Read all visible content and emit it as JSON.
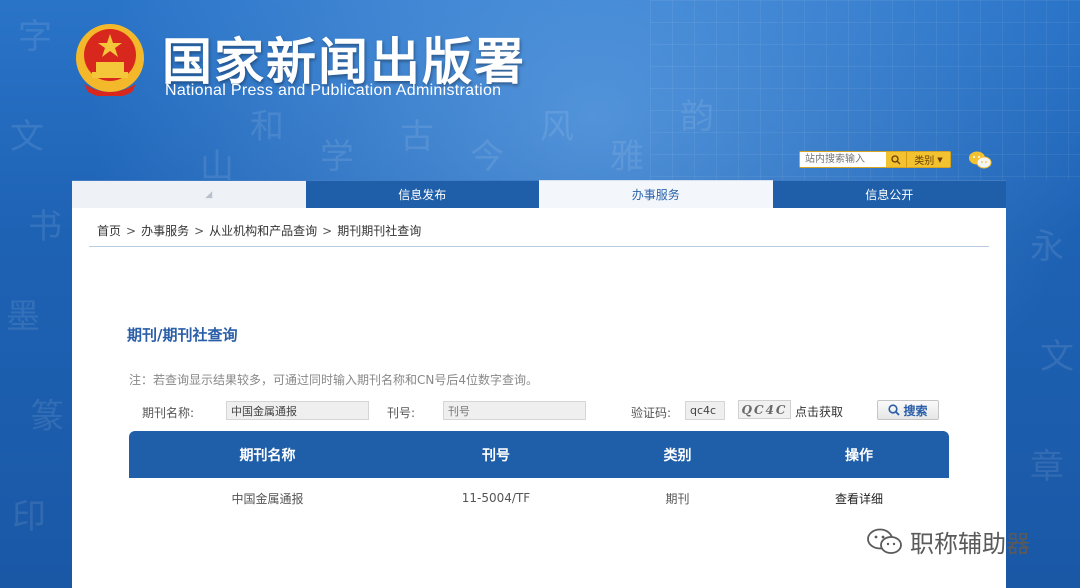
{
  "header": {
    "title": "国家新闻出版署",
    "subtitle": "National  Press and Publication Administration"
  },
  "top_search": {
    "placeholder": "站内搜索输入",
    "category_label": "类别"
  },
  "nav": {
    "items": [
      {
        "label": ""
      },
      {
        "label": "信息发布"
      },
      {
        "label": "办事服务"
      },
      {
        "label": "信息公开"
      }
    ]
  },
  "breadcrumb": {
    "items": [
      "首页",
      "办事服务",
      "从业机构和产品查询",
      "期刊期刊社查询"
    ],
    "separator": ">"
  },
  "section": {
    "title": "期刊/期刊社查询",
    "note": "注：若查询显示结果较多，可通过同时输入期刊名称和CN号后4位数字查询。"
  },
  "form": {
    "name_label": "期刊名称:",
    "name_value": "中国金属通报",
    "issn_label": "刊号:",
    "issn_placeholder": "刊号",
    "captcha_label": "验证码:",
    "captcha_value": "qc4c",
    "captcha_image_text": "QC4C",
    "refresh_label": "点击获取",
    "search_label": "搜索"
  },
  "table": {
    "headers": [
      "期刊名称",
      "刊号",
      "类别",
      "操作"
    ],
    "rows": [
      {
        "name": "中国金属通报",
        "issn": "11-5004/TF",
        "type": "期刊",
        "action": "查看详细"
      }
    ]
  },
  "watermark": {
    "text": "职称辅助器"
  },
  "colors": {
    "primary": "#1f5ea8",
    "accent": "#f2c230"
  }
}
